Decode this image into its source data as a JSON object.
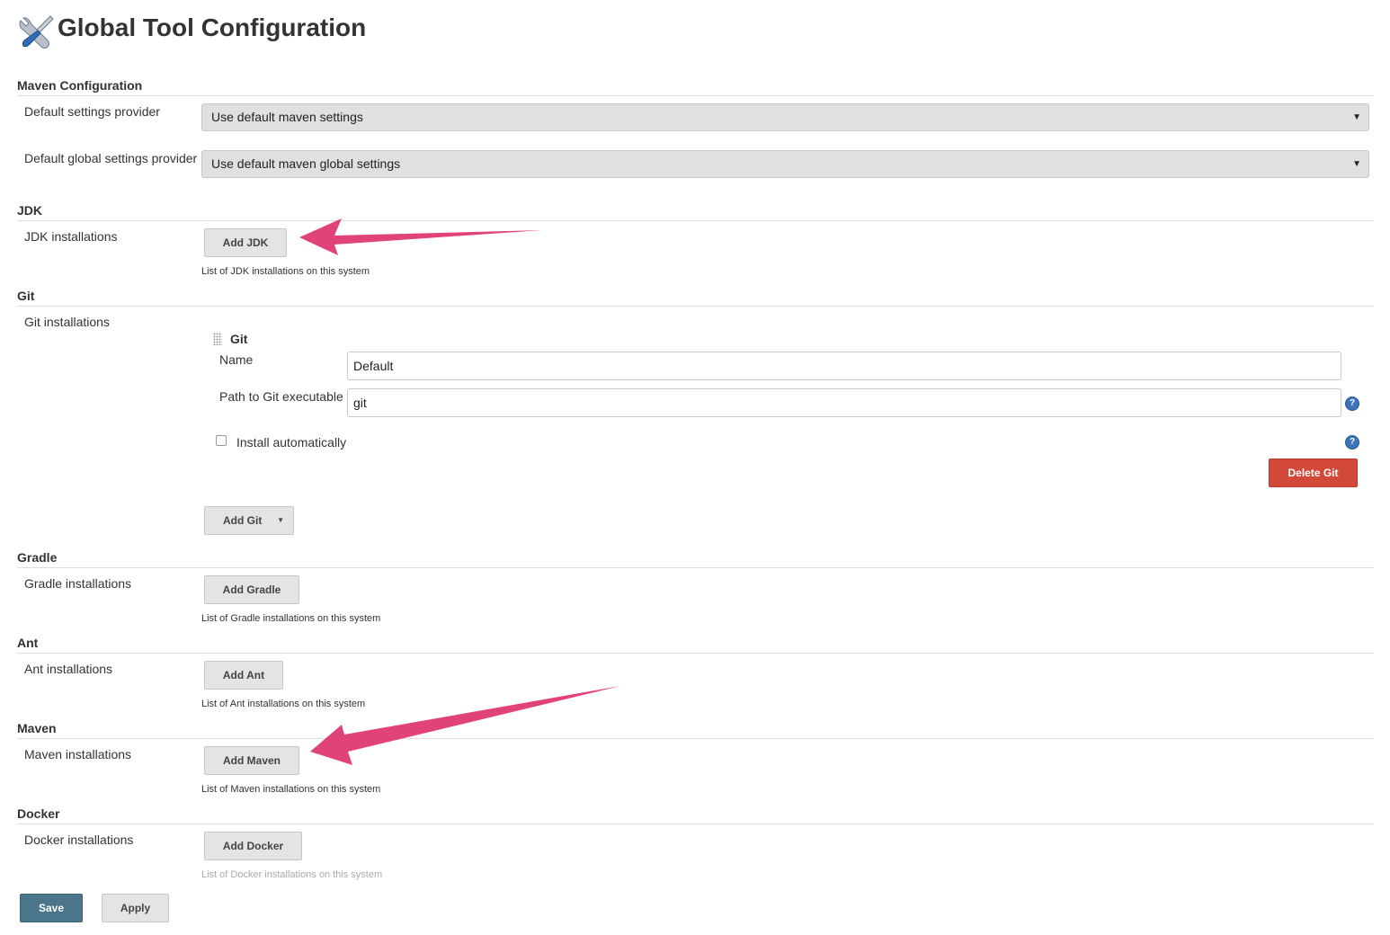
{
  "page": {
    "title": "Global Tool Configuration"
  },
  "colors": {
    "arrow": "#e0427a",
    "danger": "#d24939",
    "primary": "#4b758b",
    "help": "#3b74b8"
  },
  "sections": {
    "maven_config": {
      "heading": "Maven Configuration",
      "default_settings_label": "Default settings provider",
      "default_settings_value": "Use default maven settings",
      "default_global_label": "Default global settings provider",
      "default_global_value": "Use default maven global settings"
    },
    "jdk": {
      "heading": "JDK",
      "label": "JDK installations",
      "button": "Add JDK",
      "help": "List of JDK installations on this system"
    },
    "git": {
      "heading": "Git",
      "label": "Git installations",
      "item_title": "Git",
      "name_label": "Name",
      "name_value": "Default",
      "path_label": "Path to Git executable",
      "path_value": "git",
      "install_auto_label": "Install automatically",
      "install_auto_checked": false,
      "delete_button": "Delete Git",
      "add_button": "Add Git"
    },
    "gradle": {
      "heading": "Gradle",
      "label": "Gradle installations",
      "button": "Add Gradle",
      "help": "List of Gradle installations on this system"
    },
    "ant": {
      "heading": "Ant",
      "label": "Ant installations",
      "button": "Add Ant",
      "help": "List of Ant installations on this system"
    },
    "maven": {
      "heading": "Maven",
      "label": "Maven installations",
      "button": "Add Maven",
      "help": "List of Maven installations on this system"
    },
    "docker": {
      "heading": "Docker",
      "label": "Docker installations",
      "button": "Add Docker",
      "help": "List of Docker installations on this system"
    }
  },
  "footer": {
    "save": "Save",
    "apply": "Apply"
  },
  "icons": {
    "title": "tools-icon",
    "help": "help-icon",
    "select_caret": "caret-down-icon"
  }
}
